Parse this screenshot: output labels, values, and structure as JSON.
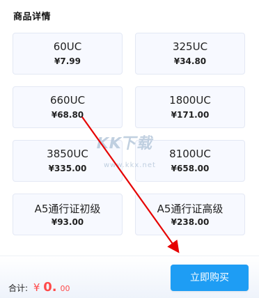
{
  "section": {
    "title": "商品详情"
  },
  "products": [
    {
      "name": "60UC",
      "price": "¥7.99"
    },
    {
      "name": "325UC",
      "price": "¥34.80"
    },
    {
      "name": "660UC",
      "price": "¥68.80"
    },
    {
      "name": "1800UC",
      "price": "¥171.00"
    },
    {
      "name": "3850UC",
      "price": "¥335.00"
    },
    {
      "name": "8100UC",
      "price": "¥658.00"
    },
    {
      "name": "A5通行证初级",
      "price": "¥93.00"
    },
    {
      "name": "A5通行证高级",
      "price": "¥238.00"
    }
  ],
  "footer": {
    "total_label": "合计:",
    "currency_symbol": "¥",
    "total_main": "0.",
    "total_cents": "00",
    "buy_label": "立即购买"
  },
  "watermark": {
    "text": "KK下载",
    "url": "www.kkx.net"
  },
  "colors": {
    "primary": "#1e9df4",
    "price_highlight": "#ff4a4a",
    "annotation": "#e60000",
    "card_background": "#f7f9ff",
    "card_border": "#e3e8f4"
  }
}
